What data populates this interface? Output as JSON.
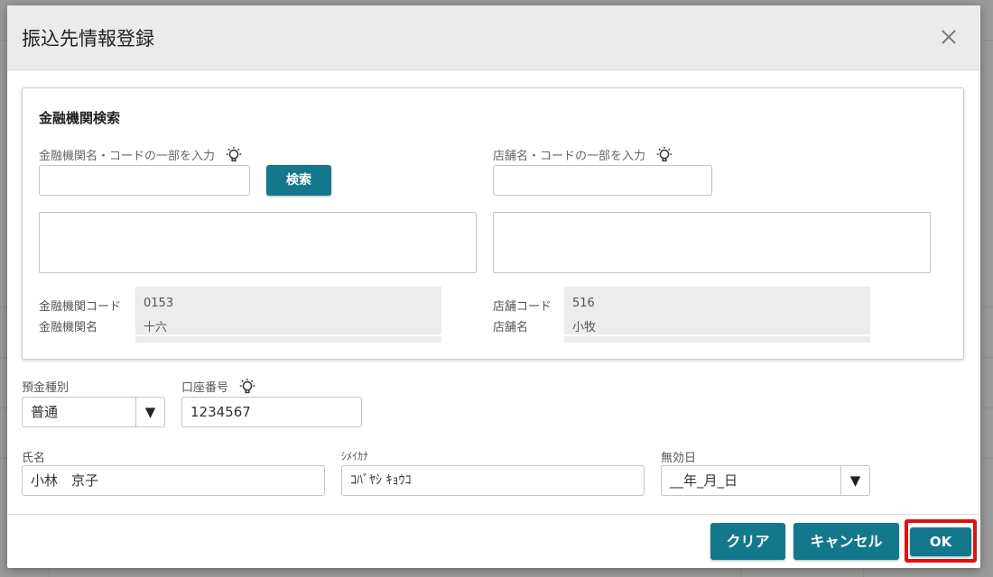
{
  "dialog": {
    "title": "振込先情報登録"
  },
  "bank_search": {
    "section_title": "金融機関検索",
    "bank_input_label": "金融機関名・コードの一部を入力",
    "bank_input_value": "",
    "search_button": "検索",
    "branch_input_label": "店舗名・コードの一部を入力",
    "branch_input_value": "",
    "bank_code_label": "金融機関コード",
    "bank_code_value": "0153",
    "bank_name_label": "金融機関名",
    "bank_name_value": "十六",
    "branch_code_label": "店舗コード",
    "branch_code_value": "516",
    "branch_name_label": "店舗名",
    "branch_name_value": "小牧"
  },
  "account": {
    "deposit_type_label": "預金種別",
    "deposit_type_value": "普通",
    "account_number_label": "口座番号",
    "account_number_value": "1234567",
    "name_label": "氏名",
    "name_value": "小林　京子",
    "kana_label": "ｼﾒｲｶﾅ",
    "kana_value": "ｺﾊﾞﾔｼ ｷｮｳｺ",
    "expiry_label": "無効日",
    "expiry_value": "__年_月_日",
    "dropdown_arrow": "▼"
  },
  "footer": {
    "clear_button": "クリア",
    "cancel_button": "キャンセル",
    "ok_button": "OK"
  },
  "colors": {
    "accent": "#14788c",
    "highlight": "#e01010",
    "header_bg": "#ebebeb",
    "readonly_bg": "#ececec"
  },
  "icons": {
    "close": "close-icon",
    "bulb": "lightbulb-icon"
  }
}
